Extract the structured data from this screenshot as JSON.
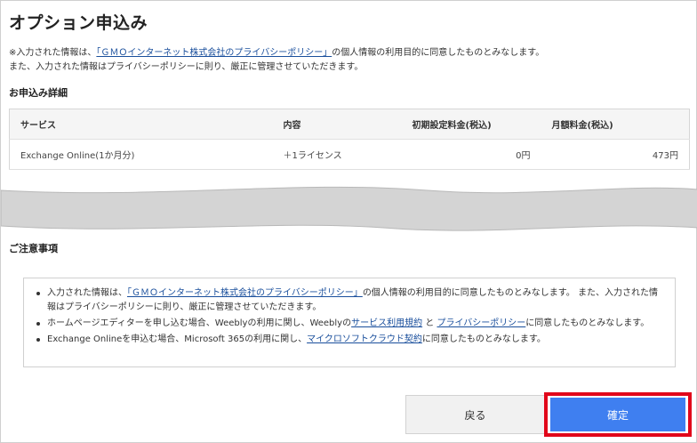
{
  "page": {
    "title": "オプション申込み"
  },
  "notice": {
    "prefix": "※入力された情報は、",
    "link": "「ＧＭＯインターネット株式会社のプライバシーポリシー」",
    "suffix": "の個人情報の利用目的に同意したものとみなします。また、入力された情報はプライバシーポリシーに則り、厳正に管理させていただきます。"
  },
  "details": {
    "title": "お申込み詳細",
    "headers": {
      "service": "サービス",
      "content": "内容",
      "initial_fee": "初期設定料金(税込)",
      "monthly_fee": "月額料金(税込)"
    },
    "rows": [
      {
        "service": "Exchange Online(1か月分)",
        "content": "＋1ライセンス",
        "initial_fee": "0円",
        "monthly_fee": "473円"
      }
    ]
  },
  "caution": {
    "title": "ご注意事項",
    "items": [
      {
        "prefix": "入力された情報は、",
        "link1": "「ＧＭＯインターネット株式会社のプライバシーポリシー」",
        "suffix": "の個人情報の利用目的に同意したものとみなします。 また、入力された情報はプライバシーポリシーに則り、厳正に管理させていただきます。"
      },
      {
        "prefix": "ホームページエディターを申し込む場合、Weeblyの利用に関し、Weeblyの",
        "link1": "サービス利用規約",
        "middle": " と ",
        "link2": "プライバシーポリシー",
        "suffix": "に同意したものとみなします。"
      },
      {
        "prefix": "Exchange Onlineを申込む場合、Microsoft 365の利用に関し、",
        "link1": "マイクロソフトクラウド契約",
        "suffix": "に同意したものとみなします。"
      }
    ]
  },
  "buttons": {
    "back": "戻る",
    "confirm": "確定"
  },
  "colors": {
    "confirm": "#3f7ff0",
    "highlight": "#e1061a",
    "link": "#1a4f9c"
  }
}
